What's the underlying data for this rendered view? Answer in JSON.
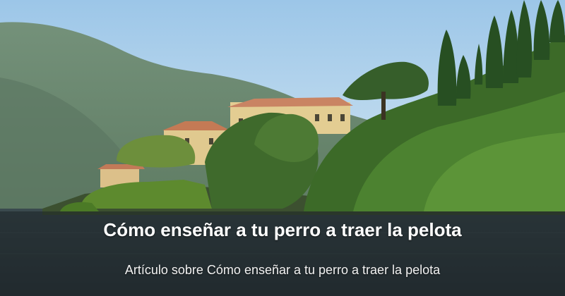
{
  "banner": {
    "title": "Cómo enseñar a tu perro a traer la pelota",
    "subtitle": "Artículo sobre Cómo enseñar a tu perro a traer la pelota"
  },
  "photo": {
    "subject": "lakeside-villa-with-cypress-trees",
    "colors": {
      "sky": "#b6d6ee",
      "mountain": "#6f8a73",
      "foliage": "#3f6a2c",
      "villa": "#e1c98c",
      "roof": "#c47a55",
      "water": "#2e3a3f",
      "overlay": "#1c2226"
    }
  }
}
